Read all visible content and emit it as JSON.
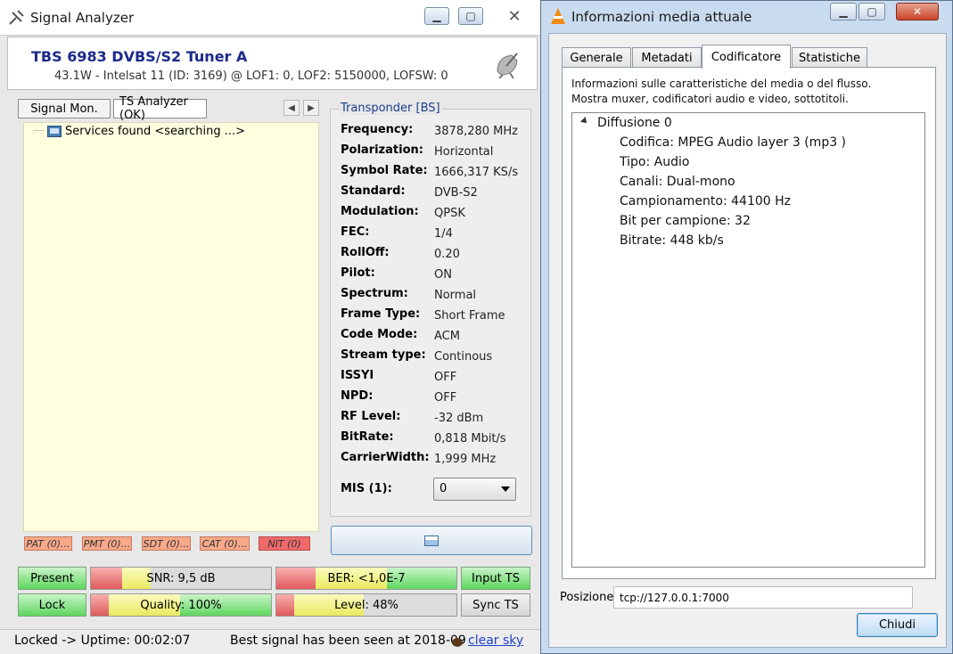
{
  "signal_analyzer": {
    "title": "Signal Analyzer",
    "device_name": "TBS 6983 DVBS/S2 Tuner A",
    "device_info": "43.1W - Intelsat 11 (ID: 3169) @ LOF1: 0, LOF2: 5150000, LOFSW: 0",
    "tabs": [
      "Signal Mon.",
      "TS Analyzer (OK)"
    ],
    "services_label": "Services found <searching ...>",
    "transponder": {
      "title": "Transponder [BS]",
      "rows": [
        {
          "k": "Frequency:",
          "v": "3878,280 MHz"
        },
        {
          "k": "Polarization:",
          "v": "Horizontal"
        },
        {
          "k": "Symbol Rate:",
          "v": "1666,317 KS/s"
        },
        {
          "k": "Standard:",
          "v": "DVB-S2"
        },
        {
          "k": "Modulation:",
          "v": "QPSK"
        },
        {
          "k": "FEC:",
          "v": "1/4"
        },
        {
          "k": "RollOff:",
          "v": "0.20"
        },
        {
          "k": "Pilot:",
          "v": "ON"
        },
        {
          "k": "Spectrum:",
          "v": "Normal"
        },
        {
          "k": "Frame Type:",
          "v": "Short Frame"
        },
        {
          "k": "Code Mode:",
          "v": "ACM"
        },
        {
          "k": "Stream type:",
          "v": "Continous"
        },
        {
          "k": "ISSYI",
          "v": "OFF"
        },
        {
          "k": "NPD:",
          "v": "OFF"
        },
        {
          "k": "RF Level:",
          "v": "-32 dBm"
        },
        {
          "k": "BitRate:",
          "v": "0,818 Mbit/s"
        },
        {
          "k": "CarrierWidth:",
          "v": "1,999 MHz"
        }
      ],
      "mis_label": "MIS (1):",
      "mis_value": "0"
    },
    "tables": [
      "PAT (0)...",
      "PMT (0)...",
      "SDT (0)...",
      "CAT (0)...",
      "NIT (0)"
    ],
    "indicators": {
      "present": "Present",
      "lock": "Lock",
      "snr": "SNR: 9,5 dB",
      "quality": "Quality: 100%",
      "quality_level": 1.0,
      "ber": "BER: <1,0E-7",
      "level": "Level: 48%",
      "level_value": 0.48,
      "input_ts": "Input TS",
      "sync_ts": "Sync TS"
    },
    "status": {
      "uptime": "Locked -> Uptime: 00:02:07",
      "best": "Best signal has been seen at 2018-09",
      "link": "clear sky"
    }
  },
  "vlc": {
    "title": "Informazioni media attuale",
    "tabs": [
      "Generale",
      "Metadati",
      "Codificatore",
      "Statistiche"
    ],
    "active_tab": "Codificatore",
    "description_line1": "Informazioni sulle caratteristiche del media o del flusso.",
    "description_line2": "Mostra muxer, codificatori audio e video, sottotitoli.",
    "stream_title": "Diffusione 0",
    "stream_items": [
      "Codifica: MPEG Audio layer 3 (mp3 )",
      "Tipo: Audio",
      "Canali: Dual-mono",
      "Campionamento: 44100 Hz",
      "Bit per campione: 32",
      "Bitrate: 448 kb/s"
    ],
    "position_label": "Posizione:",
    "position_value": "tcp://127.0.0.1:7000",
    "close_label": "Chiudi"
  },
  "colors": {
    "accent_blue": "#1b2a8a",
    "green": "#5fd65f",
    "red": "#e06060",
    "yellow": "#f0f080"
  }
}
